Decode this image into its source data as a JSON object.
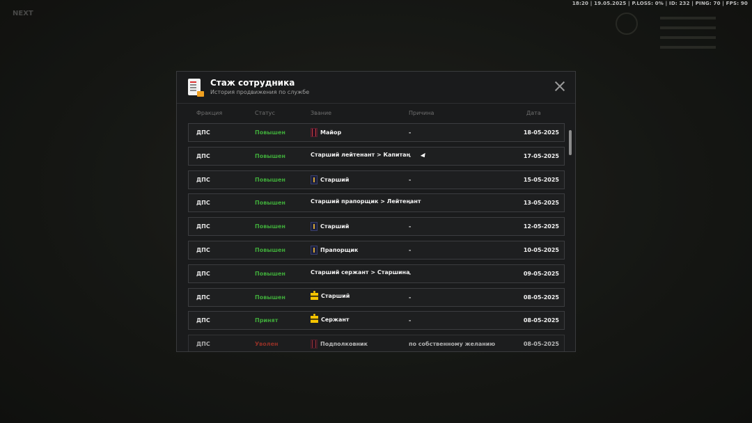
{
  "hud": {
    "status_line": "18:20 | 19.05.2025 | P.LOSS: 0% | ID: 232 | PING: 70 | FPS: 90"
  },
  "modal": {
    "title": "Стаж сотрудника",
    "subtitle": "История продвижения по службе",
    "icons": {
      "header": "document-icon",
      "close": "close-icon"
    }
  },
  "columns": {
    "faction": "Фракция",
    "status": "Статус",
    "rank": "Звание",
    "reason": "Причина",
    "date": "Дата"
  },
  "colors": {
    "promoted": "#3fa93a",
    "fired": "#c0392b",
    "background": "#1a1b1c"
  },
  "rows": [
    {
      "faction": "ДПС",
      "status": "Повышен",
      "rank": "Майор",
      "insignia": "maroon-stripes-icon",
      "reason": "-",
      "date": "18-05-2025"
    },
    {
      "faction": "ДПС",
      "status": "Повышен",
      "rank": "Старший лейтенант > Капитан",
      "insignia": "",
      "reason": "-",
      "date": "17-05-2025"
    },
    {
      "faction": "ДПС",
      "status": "Повышен",
      "rank": "Старший",
      "insignia": "navy-epaulette-icon",
      "reason": "-",
      "date": "15-05-2025"
    },
    {
      "faction": "ДПС",
      "status": "Повышен",
      "rank": "Старший прапорщик > Лейтенант",
      "insignia": "",
      "reason": "-",
      "date": "13-05-2025"
    },
    {
      "faction": "ДПС",
      "status": "Повышен",
      "rank": "Старший",
      "insignia": "navy-epaulette-icon",
      "reason": "-",
      "date": "12-05-2025"
    },
    {
      "faction": "ДПС",
      "status": "Повышен",
      "rank": "Прапорщик",
      "insignia": "navy-epaulette-icon",
      "reason": "-",
      "date": "10-05-2025"
    },
    {
      "faction": "ДПС",
      "status": "Повышен",
      "rank": "Старший сержант > Старшина",
      "insignia": "",
      "reason": "-",
      "date": "09-05-2025"
    },
    {
      "faction": "ДПС",
      "status": "Повышен",
      "rank": "Старший",
      "insignia": "gold-stripes-icon",
      "reason": "-",
      "date": "08-05-2025"
    },
    {
      "faction": "ДПС",
      "status": "Принят",
      "rank": "Сержант",
      "insignia": "gold-stripes-icon",
      "reason": "-",
      "date": "08-05-2025"
    },
    {
      "faction": "ДПС",
      "status": "Уволен",
      "rank": "Подполковник",
      "insignia": "maroon-stripes-icon",
      "reason": "по собственному желанию",
      "date": "08-05-2025"
    }
  ]
}
